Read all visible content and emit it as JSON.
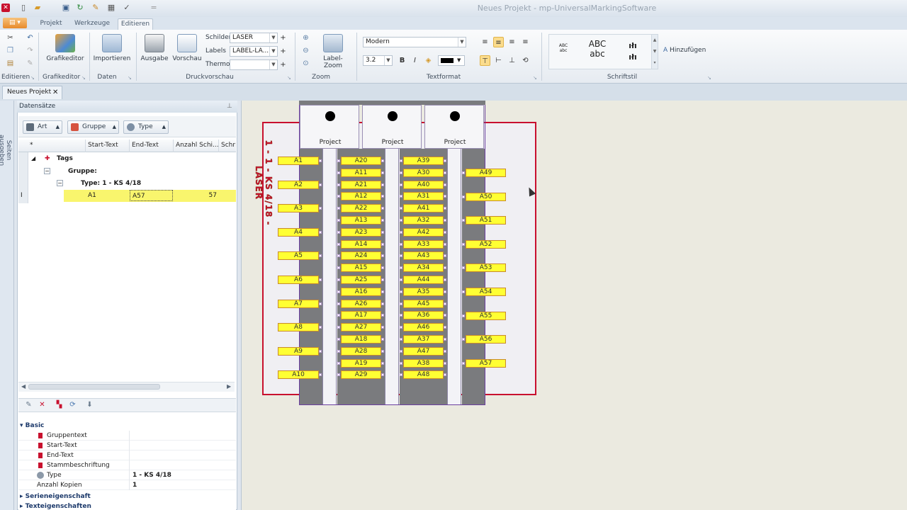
{
  "window": {
    "title": "Neues Projekt - mp-UniversalMarkingSoftware"
  },
  "menu": {
    "file_label": "",
    "tabs": [
      "Projekt",
      "Werkzeuge",
      "Editieren"
    ]
  },
  "ribbon": {
    "groups": {
      "editieren": "Editieren",
      "grafikeditor": "Grafikeditor",
      "daten": "Daten",
      "druckvorschau": "Druckvorschau",
      "zoom": "Zoom",
      "textformat": "Textformat",
      "schriftstil": "Schriftstil"
    },
    "buttons": {
      "grafikeditor": "Grafikeditor",
      "importieren": "Importieren",
      "ausgabe": "Ausgabe",
      "vorschau": "Vorschau",
      "label_zoom": "Label-Zoom",
      "hinzufuegen": "Hinzufügen"
    },
    "fields": {
      "schilder_label": "Schilder",
      "schilder_value": "LASER",
      "labels_label": "Labels",
      "labels_value": "LABEL-LA...",
      "thermo_label": "Thermo",
      "thermo_value": ""
    },
    "font": {
      "name": "Modern",
      "size": "3.2"
    },
    "styles": {
      "style1": "ABC abc",
      "style2a": "ABC",
      "style2b": "abc"
    }
  },
  "doc_tab": {
    "label": "Neues Projekt"
  },
  "strip": {
    "label": "Seiten ausgeben"
  },
  "panel": {
    "title": "Datensätze",
    "group_chips": [
      "Art",
      "Gruppe",
      "Type"
    ],
    "columns": [
      "Start-Text",
      "End-Text",
      "Anzahl Schi...",
      "Schri"
    ],
    "tree": {
      "star": "*",
      "tags": "Tags",
      "gruppe": "Gruppe:",
      "type": "Type: 1 - KS 4/18"
    },
    "row": {
      "start": "A1",
      "end": "A57",
      "count": "57"
    }
  },
  "properties": {
    "section_basic": "Basic",
    "rows": [
      {
        "label": "Gruppentext",
        "value": ""
      },
      {
        "label": "Start-Text",
        "value": ""
      },
      {
        "label": "End-Text",
        "value": ""
      },
      {
        "label": "Stammbeschriftung",
        "value": ""
      },
      {
        "label": "Type",
        "value": "1 - KS 4/18"
      },
      {
        "label": "Anzahl Kopien",
        "value": "1"
      }
    ],
    "section_serie": "Serieneigenschaft",
    "section_text": "Texteigenschaften"
  },
  "design": {
    "vertical_label": "1 - 1 - KS 4/18 - LASER",
    "header_text": "Project",
    "accent": "#c8102e",
    "label_fill": "#ffff33",
    "columns": [
      {
        "labels": [
          "A1",
          "A2",
          "A3",
          "A4",
          "A5",
          "A6",
          "A7",
          "A8",
          "A9",
          "A10"
        ],
        "spacing": "double"
      },
      {
        "labels": [
          "A20",
          "A11",
          "A21",
          "A12",
          "A22",
          "A13",
          "A23",
          "A14",
          "A24",
          "A15",
          "A25",
          "A16",
          "A26",
          "A17",
          "A27",
          "A18",
          "A28",
          "A19",
          "A29"
        ],
        "spacing": "single"
      },
      {
        "labels": [
          "A39",
          "A30",
          "A40",
          "A31",
          "A41",
          "A32",
          "A42",
          "A33",
          "A43",
          "A34",
          "A44",
          "A35",
          "A45",
          "A36",
          "A46",
          "A37",
          "A47",
          "A38",
          "A48"
        ],
        "spacing": "single"
      },
      {
        "labels": [
          "A49",
          "A50",
          "A51",
          "A52",
          "A53",
          "A54",
          "A55",
          "A56",
          "A57"
        ],
        "spacing": "double-offset"
      }
    ]
  }
}
